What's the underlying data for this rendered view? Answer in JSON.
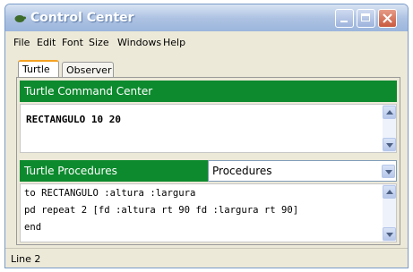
{
  "window": {
    "title": "Control Center"
  },
  "menu": {
    "items": [
      "File",
      "Edit",
      "Font",
      "Size",
      "Windows",
      "Help"
    ]
  },
  "tabs": [
    {
      "label": "Turtle"
    },
    {
      "label": "Observer"
    }
  ],
  "command_center": {
    "header": "Turtle Command Center",
    "text": "RECTANGULO 10 20"
  },
  "procedures": {
    "header": "Turtle Procedures",
    "selected": "Procedures",
    "lines": [
      "to RECTANGULO :altura :largura",
      "pd repeat 2 [fd :altura rt 90 fd :largura rt 90]",
      "end"
    ]
  },
  "status": {
    "text": "Line 2"
  }
}
